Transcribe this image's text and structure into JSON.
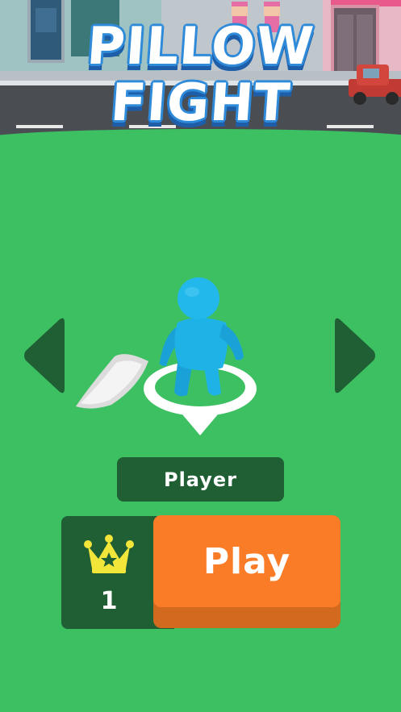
{
  "game": {
    "title_line1": "PILLOW",
    "title_line2": "FIGHT"
  },
  "selector": {
    "prev_icon": "chevron-left-icon",
    "next_icon": "chevron-right-icon",
    "player_name": "Player"
  },
  "rank": {
    "icon": "crown-icon",
    "value": "1"
  },
  "actions": {
    "play_label": "Play"
  },
  "colors": {
    "grass": "#3cc062",
    "panel": "#1f5f33",
    "play": "#fb7c27",
    "crown": "#f3e63a",
    "character": "#1fb2e6"
  }
}
